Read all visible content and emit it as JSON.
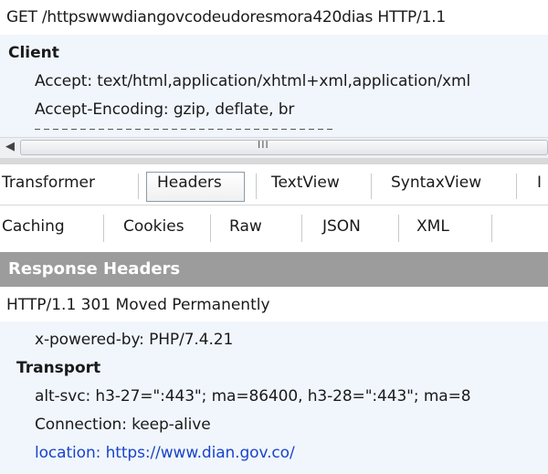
{
  "request_line": "GET /httpswwwdiangovcodeudoresmora420dias HTTP/1.1",
  "request_headers": {
    "section": "Client",
    "items": [
      "Accept: text/html,application/xhtml+xml,application/xml",
      "Accept-Encoding: gzip, deflate, br"
    ]
  },
  "scrollbar": {
    "left_arrow": "◀",
    "grip": "III"
  },
  "tabs_row1": [
    "Transformer",
    "Headers",
    "TextView",
    "SyntaxView",
    "I"
  ],
  "tabs_row2": [
    "Caching",
    "Cookies",
    "Raw",
    "JSON",
    "XML"
  ],
  "selected_tab": "Headers",
  "response": {
    "bar_title": "Response Headers",
    "status_line": "HTTP/1.1 301 Moved Permanently",
    "misc_header": "x-powered-by: PHP/7.4.21",
    "transport_section": "Transport",
    "transport_items": [
      "alt-svc: h3-27=\":443\"; ma=86400, h3-28=\":443\"; ma=8",
      "Connection: keep-alive"
    ],
    "location": "location: https://www.dian.gov.co/"
  }
}
